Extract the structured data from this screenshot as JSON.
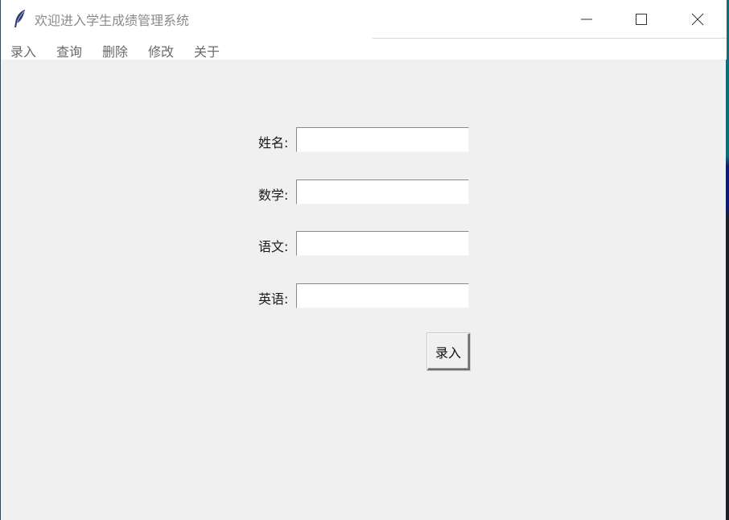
{
  "window": {
    "title": "欢迎进入学生成绩管理系统"
  },
  "menu": {
    "items": [
      {
        "label": "录入"
      },
      {
        "label": "查询"
      },
      {
        "label": "删除"
      },
      {
        "label": "修改"
      },
      {
        "label": "关于"
      }
    ]
  },
  "form": {
    "fields": [
      {
        "label": "姓名:",
        "value": ""
      },
      {
        "label": "数学:",
        "value": ""
      },
      {
        "label": "语文:",
        "value": ""
      },
      {
        "label": "英语:",
        "value": ""
      }
    ],
    "submit_label": "录入"
  },
  "icons": {
    "app": "feather-icon",
    "minimize": "minimize-icon",
    "maximize": "maximize-icon",
    "close": "close-icon"
  }
}
